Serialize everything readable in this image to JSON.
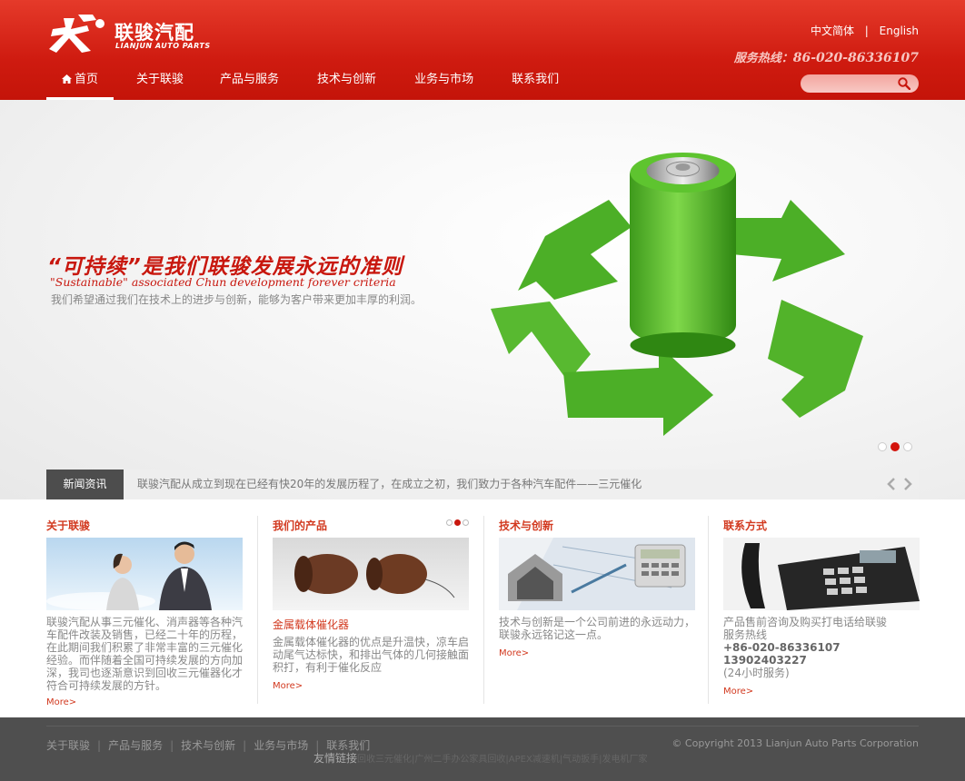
{
  "brand": {
    "name_cn": "联骏汽配",
    "name_en": "LIANJUN AUTO PARTS"
  },
  "lang": {
    "cn": "中文简体",
    "separator": "|",
    "en": "English"
  },
  "hotline": {
    "label": "服务热线：",
    "number": "86-020-86336107"
  },
  "nav": {
    "items": [
      {
        "label": "首页",
        "active": true,
        "icon": "home-icon"
      },
      {
        "label": "关于联骏"
      },
      {
        "label": "产品与服务"
      },
      {
        "label": "技术与创新"
      },
      {
        "label": "业务与市场"
      },
      {
        "label": "联系我们"
      }
    ]
  },
  "search": {
    "placeholder": "",
    "icon": "search-icon"
  },
  "banner": {
    "headline": "“可持续”是我们联骏发展永远的准则",
    "subline": "\"Sustainable\" associated Chun development forever criteria",
    "desc": "我们希望通过我们在技术上的进步与创新，能够为客户带来更加丰厚的利润。",
    "active_slide": 2,
    "slide_count": 3
  },
  "news": {
    "tag": "新闻资讯",
    "text": "联骏汽配从成立到现在已经有快20年的发展历程了，在成立之初，我们致力于各种汽车配件——三元催化"
  },
  "sections": {
    "about": {
      "title": "关于联骏",
      "lines": [
        "联骏汽配从事三元催化、消声器等各种汽",
        "车配件改装及销售，已经二十年的历程，",
        "在此期间我们积累了非常丰富的三元催化",
        "经验。而伴随着全国可持续发展的方向加",
        "深，我司也逐渐意识到回收三元催器化才",
        "符合可持续发展的方针。"
      ],
      "more": "More>"
    },
    "products": {
      "title": "我们的产品",
      "subtitle": "金属载体催化器",
      "lines": [
        "金属载体催化器的优点是升温快，凉车启",
        "动尾气达标快，和排出气体的几何接触面",
        "积打，有利于催化反应"
      ],
      "more": "More>"
    },
    "tech": {
      "title": "技术与创新",
      "lines": [
        "技术与创新是一个公司前进的永远动力，",
        "联骏永远铭记这一点。"
      ],
      "more": "More>"
    },
    "contact": {
      "title": "联系方式",
      "line1": "产品售前咨询及购买打电话给联骏",
      "line2": "服务热线",
      "phone1": "+86-020-86336107",
      "phone2": "13902403227",
      "hours": "(24小时服务)",
      "more": "More>"
    }
  },
  "footer": {
    "links": [
      "关于联骏",
      "产品与服务",
      "技术与创新",
      "业务与市场",
      "联系我们"
    ],
    "friends_label": "友情链接",
    "friends": "回收三元催化|广州二手办公家具回收|APEX减速机|气动扳手|发电机厂家",
    "copyright": "© Copyright 2013 Lianjun Auto Parts Corporation"
  },
  "colors": {
    "brand_red": "#d3140c",
    "accent_text": "#d2391f",
    "footer_bg": "#4f4f4f",
    "recycle_green": "#4caf27"
  }
}
